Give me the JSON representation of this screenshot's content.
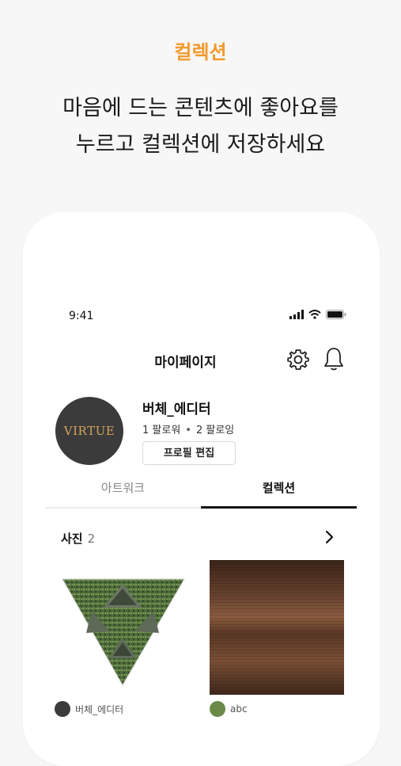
{
  "promo": {
    "tag": "컬렉션",
    "headline_line1": "마음에 드는 콘텐츠에 좋아요를",
    "headline_line2": "누르고 컬렉션에 저장하세요"
  },
  "status_bar": {
    "time": "9:41"
  },
  "nav": {
    "title": "마이페이지",
    "settings_icon": "gear-icon",
    "notification_icon": "bell-icon"
  },
  "profile": {
    "avatar_text": "VIRTUE",
    "username": "버체_에디터",
    "followers": "1 팔로워",
    "following": "2 팔로잉",
    "separator": "•",
    "edit_label": "프로필 편집"
  },
  "tabs": [
    {
      "label": "아트워크",
      "active": false
    },
    {
      "label": "컬렉션",
      "active": true
    }
  ],
  "section": {
    "title": "사진",
    "count": "2"
  },
  "items": [
    {
      "owner": "버체_에디터"
    },
    {
      "owner": "abc"
    }
  ],
  "colors": {
    "accent": "#f39a2b",
    "background": "#f7f7f7",
    "avatar_bg": "#3b3b3b"
  }
}
